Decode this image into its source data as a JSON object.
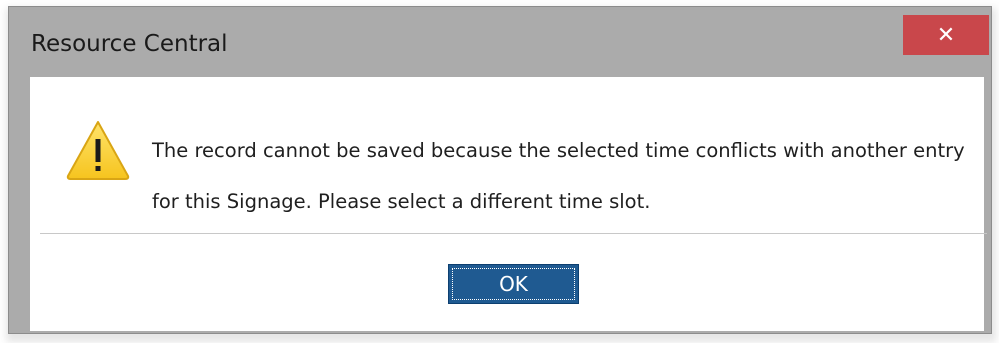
{
  "window": {
    "title": "Resource Central",
    "close_glyph": "✕"
  },
  "dialog": {
    "icon": "warning-icon",
    "message": "The record cannot be saved because the selected time conflicts with another entry for this Signage. Please select a different time slot.",
    "ok_label": "OK"
  },
  "colors": {
    "close_button": "#c9474b",
    "ok_button": "#1f5a91",
    "warning_fill": "#fbd33a"
  }
}
